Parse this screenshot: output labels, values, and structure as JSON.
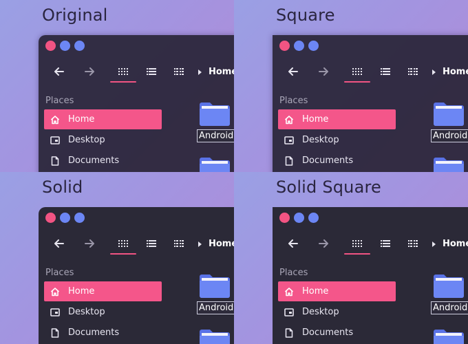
{
  "variants": [
    {
      "label": "Original"
    },
    {
      "label": "Square"
    },
    {
      "label": "Solid"
    },
    {
      "label": "Solid Square"
    }
  ],
  "window": {
    "controls": [
      "close",
      "minimize",
      "maximize"
    ],
    "toolbar": {
      "back_icon": "arrow-left-icon",
      "forward_icon": "arrow-right-icon",
      "view_grid_icon": "grid-view-icon",
      "view_list_icon": "list-view-icon",
      "view_compact_icon": "compact-view-icon",
      "breadcrumb": "Home"
    },
    "sidebar": {
      "header": "Places",
      "items": [
        {
          "label": "Home",
          "icon": "home-icon",
          "active": true
        },
        {
          "label": "Desktop",
          "icon": "desktop-icon",
          "active": false
        },
        {
          "label": "Documents",
          "icon": "document-icon",
          "active": false
        }
      ]
    },
    "files": [
      {
        "label": "Android",
        "icon": "folder-icon"
      }
    ]
  },
  "colors": {
    "accent": "#f4568a",
    "folder": "#6c86f4",
    "window_translucent": "#282436",
    "window_solid": "#2b2937"
  }
}
